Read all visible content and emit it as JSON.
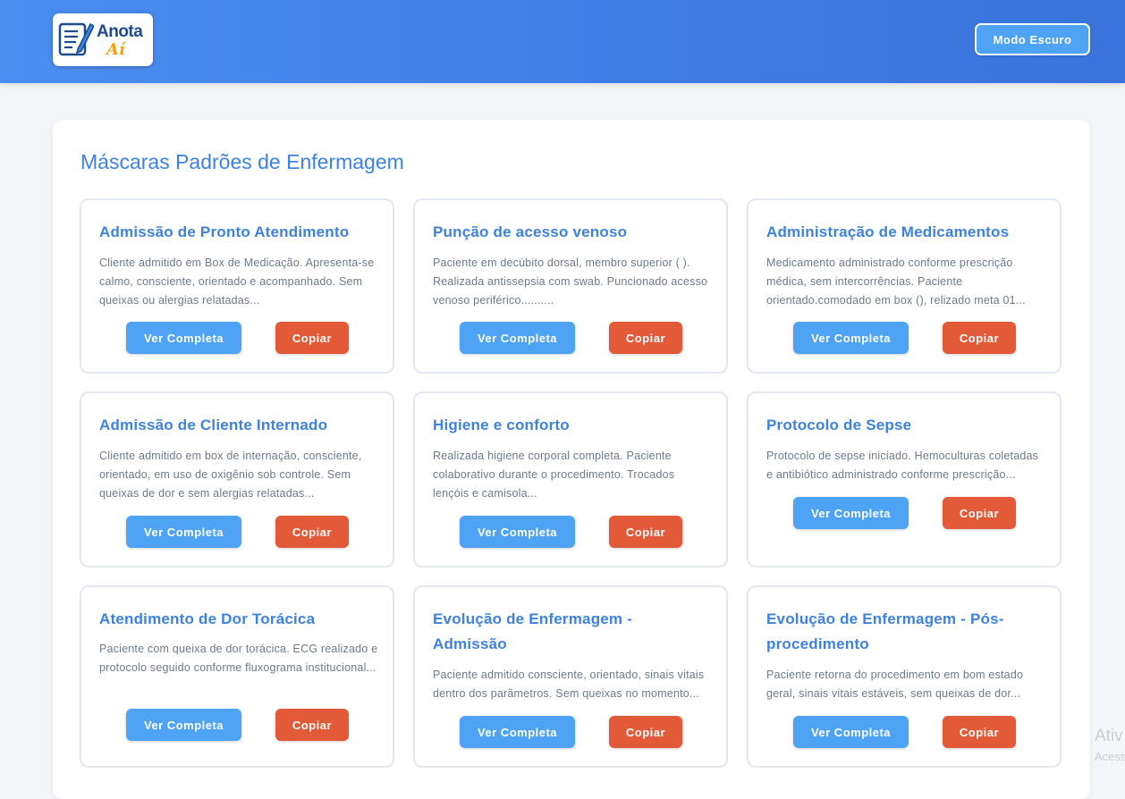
{
  "header": {
    "logo_text_1": "Anota",
    "logo_text_2": "Aí",
    "dark_mode_label": "Modo Escuro"
  },
  "page_title": "Máscaras Padrões de Enfermagem",
  "buttons": {
    "view_label": "Ver Completa",
    "copy_label": "Copiar"
  },
  "cards": [
    {
      "title": "Admissão de Pronto Atendimento",
      "desc": "Cliente admitido em Box de Medicação. Apresenta-se calmo, consciente, orientado e acompanhado. Sem queixas ou alergias relatadas..."
    },
    {
      "title": "Punção de acesso venoso",
      "desc": "Paciente em decúbito dorsal, membro superior ( ). Realizada antissepsia com swab. Puncionado acesso venoso periférico.........."
    },
    {
      "title": "Administração de Medicamentos",
      "desc": "Medicamento administrado conforme prescrição médica, sem intercorrências. Paciente orientado.comodado em box (), relizado meta 01..."
    },
    {
      "title": "Admissão de Cliente Internado",
      "desc": "Cliente admitido em box de internação, consciente, orientado, em uso de oxigênio sob controle. Sem queixas de dor e sem alergias relatadas..."
    },
    {
      "title": "Higiene e conforto",
      "desc": "Realizada higiene corporal completa. Paciente colaborativo durante o procedimento. Trocados lençóis e camisola..."
    },
    {
      "title": "Protocolo de Sepse",
      "desc": "Protocolo de sepse iniciado. Hemoculturas coletadas e antibiótico administrado conforme prescrição..."
    },
    {
      "title": "Atendimento de Dor Torácica",
      "desc": "Paciente com queixa de dor torácica. ECG realizado e protocolo seguido conforme fluxograma institucional..."
    },
    {
      "title": "Evolução de Enfermagem - Admissão",
      "desc": "Paciente admitido consciente, orientado, sinais vitais dentro dos parâmetros. Sem queixas no momento..."
    },
    {
      "title": "Evolução de Enfermagem - Pós-procedimento",
      "desc": "Paciente retorna do procedimento em bom estado geral, sinais vitais estáveis, sem queixas de dor..."
    }
  ],
  "watermark": {
    "line1": "Ativ",
    "line2": "Acess"
  },
  "colors": {
    "accent": "#3d82e0",
    "view_button": "#4ea3f5",
    "copy_button": "#e25a38"
  }
}
